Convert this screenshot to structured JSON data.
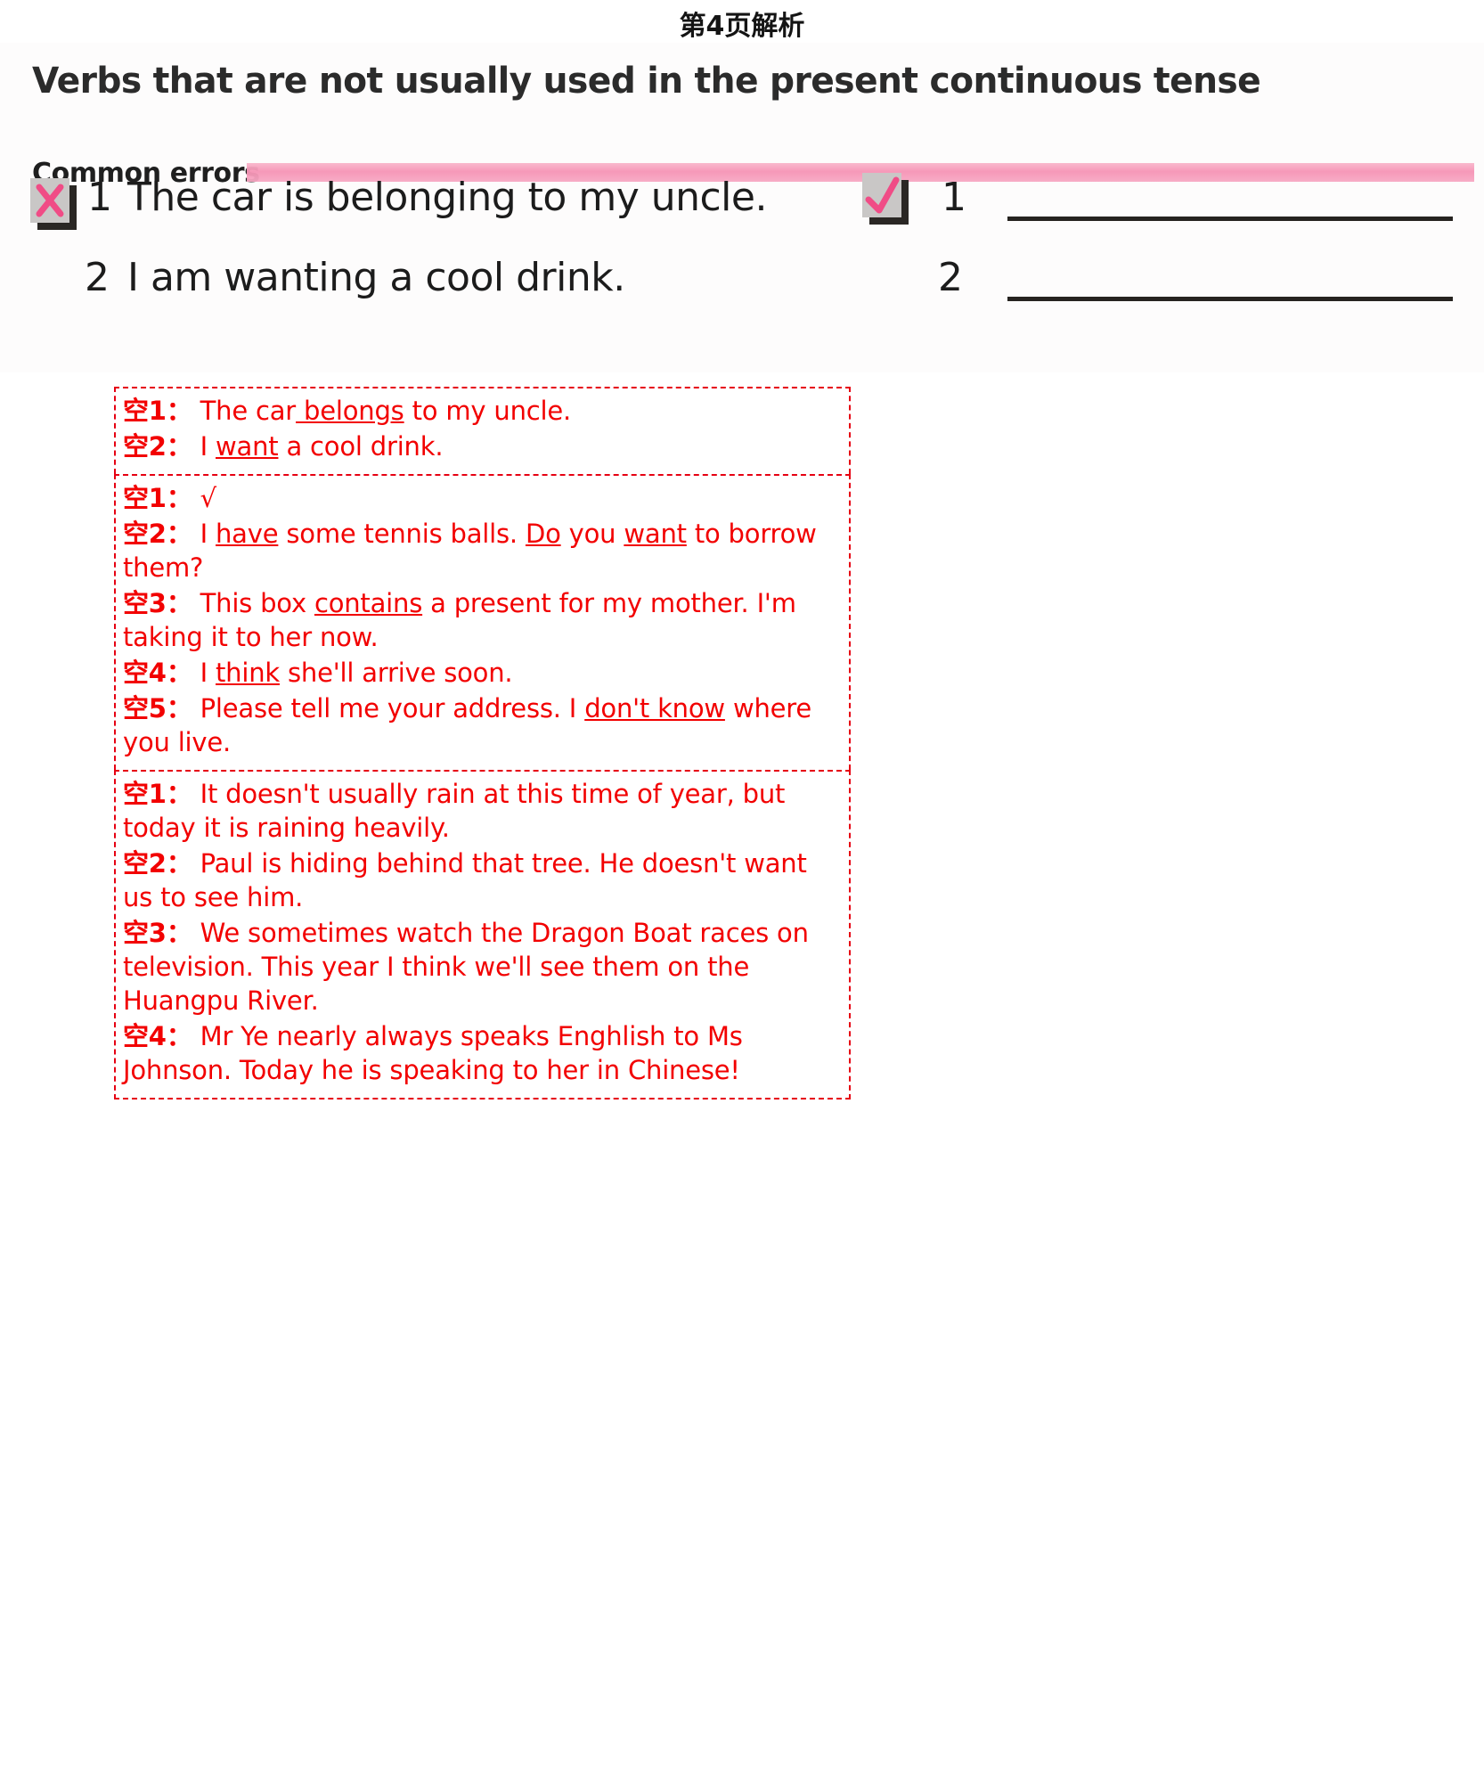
{
  "page": {
    "title": "第4页解析"
  },
  "scan": {
    "heading": "Verbs that are not usually used in the present continuous tense",
    "section_label": "Common errors",
    "wrong_icon": "cross-mark-icon",
    "right_icon": "check-mark-icon",
    "wrong_items": [
      {
        "num": "1",
        "text": "The car is belonging to my uncle."
      },
      {
        "num": "2",
        "text": "I am wanting a cool drink."
      }
    ],
    "right_items": [
      {
        "num": "1",
        "text": ""
      },
      {
        "num": "2",
        "text": ""
      }
    ]
  },
  "annotations": {
    "groups": [
      {
        "lines": [
          {
            "label": "空1：",
            "html": "The car<u> belongs</u> to my uncle."
          },
          {
            "label": "空2：",
            "html": "I <u>want</u> a cool drink."
          }
        ]
      },
      {
        "lines": [
          {
            "label": "空1：",
            "html": "√"
          },
          {
            "label": "空2：",
            "html": "I <u>have</u> some tennis balls. <u>Do</u> you <u>want</u> to borrow them?"
          },
          {
            "label": "空3：",
            "html": "This box <u>contains</u> a present for my mother. I'm taking it to her now."
          },
          {
            "label": "空4：",
            "html": "I <u>think</u> she'll arrive soon."
          },
          {
            "label": "空5：",
            "html": "Please tell me your address. I <u>don't know</u> where you live."
          }
        ]
      },
      {
        "lines": [
          {
            "label": "空1：",
            "html": "It doesn't usually rain at this time of year, but today it is raining heavily."
          },
          {
            "label": "空2：",
            "html": "Paul is hiding behind that tree. He doesn't want us to see him."
          },
          {
            "label": "空3：",
            "html": "We sometimes watch the Dragon Boat races on television. This year I think we'll see them on the Huangpu River."
          },
          {
            "label": "空4：",
            "html": "Mr Ye nearly always speaks Enghlish to Ms Johnson. Today he is speaking to her in Chinese!"
          }
        ]
      }
    ]
  },
  "colors": {
    "annotation_red": "#f20000",
    "rule_pink": "#f693b5",
    "ink_black": "#1c1c1c"
  }
}
